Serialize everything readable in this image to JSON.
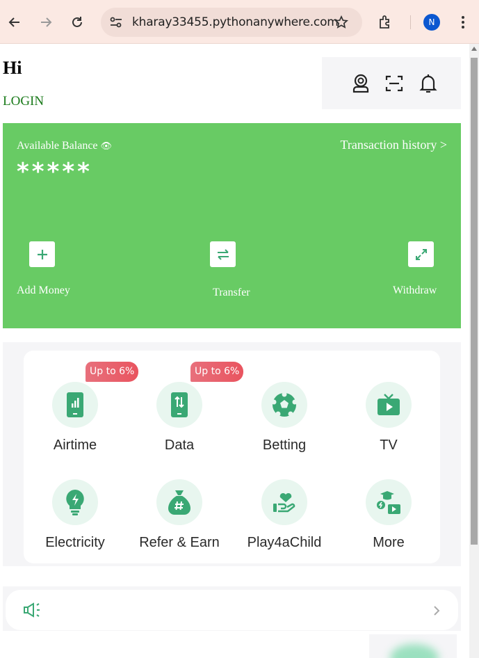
{
  "browser": {
    "url": "kharay33455.pythonanywhere.com",
    "profile_initial": "N",
    "icons": [
      "back-icon",
      "forward-icon",
      "reload-icon",
      "site-info-icon",
      "bookmark-star-icon",
      "extensions-icon",
      "menu-icon"
    ]
  },
  "header": {
    "greeting": "Hi",
    "login_label": "LOGIN",
    "icons": [
      "support-agent-icon",
      "scan-icon",
      "notification-bell-icon"
    ]
  },
  "balance": {
    "label": "Available Balance",
    "visibility_icon": "👁",
    "masked_value": "*****",
    "history_link": "Transaction history >",
    "actions": [
      {
        "label": "Add Money",
        "icon": "plus-icon"
      },
      {
        "label": "Transfer",
        "icon": "transfer-arrows-icon"
      },
      {
        "label": "Withdraw",
        "icon": "expand-arrows-icon"
      }
    ],
    "accent_color": "#68cb64"
  },
  "services": {
    "items": [
      {
        "label": "Airtime",
        "icon": "phone-signal-icon",
        "badge": "Up to 6%"
      },
      {
        "label": "Data",
        "icon": "phone-data-icon",
        "badge": "Up to 6%"
      },
      {
        "label": "Betting",
        "icon": "football-icon"
      },
      {
        "label": "TV",
        "icon": "tv-play-icon"
      },
      {
        "label": "Electricity",
        "icon": "lightbulb-bolt-icon"
      },
      {
        "label": "Refer & Earn",
        "icon": "money-bag-icon"
      },
      {
        "label": "Play4aChild",
        "icon": "heart-hand-icon"
      },
      {
        "label": "More",
        "icon": "more-services-icon"
      }
    ],
    "icon_color": "#3aa874",
    "icon_bg": "#e8f6ef"
  },
  "notice": {
    "icons": [
      "megaphone-icon",
      "chevron-right-icon"
    ]
  }
}
